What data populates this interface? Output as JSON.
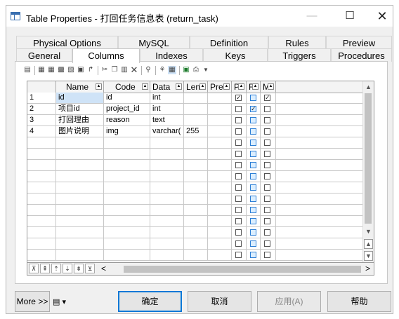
{
  "window": {
    "title": "Table Properties - 打回任务信息表 (return_task)",
    "minimize_label": "—",
    "maximize_label": "☐",
    "close_label": "✕"
  },
  "tabs": {
    "row1": [
      "Physical Options",
      "MySQL",
      "Definition",
      "Rules",
      "Preview"
    ],
    "row2": [
      "General",
      "Columns",
      "Indexes",
      "Keys",
      "Triggers",
      "Procedures"
    ],
    "active": "Columns"
  },
  "toolbar": {
    "icons": [
      "properties-icon",
      "insert-row-icon",
      "add-row-icon",
      "add-rows-icon",
      "delete-row-icon",
      "filter-icon",
      "cut-icon",
      "copy-icon",
      "paste-icon",
      "delete-icon",
      "find-icon",
      "customize-filter-icon",
      "customize-columns-icon",
      "excel-export-icon",
      "print-icon",
      "dropdown-icon"
    ]
  },
  "grid": {
    "columns": [
      "Name",
      "Code",
      "Data",
      "Len",
      "Pre",
      "P",
      "F",
      "M"
    ],
    "rows": [
      {
        "num": "1",
        "name": "id",
        "code": "id",
        "data": "int",
        "len": "",
        "pre": "",
        "p": true,
        "f": false,
        "m": true
      },
      {
        "num": "2",
        "name": "项目id",
        "code": "project_id",
        "data": "int",
        "len": "",
        "pre": "",
        "p": false,
        "f": true,
        "m": false
      },
      {
        "num": "3",
        "name": "打回理由",
        "code": "reason",
        "data": "text",
        "len": "",
        "pre": "",
        "p": false,
        "f": false,
        "m": false
      },
      {
        "num": "4",
        "name": "图片说明",
        "code": "img",
        "data": "varchar(",
        "len": "255",
        "pre": "",
        "p": false,
        "f": false,
        "m": false
      }
    ],
    "empty_rows": 11
  },
  "nav": {
    "buttons": [
      "⊼",
      "⇞",
      "⇡",
      "⇣",
      "⇟",
      "⊻"
    ],
    "scroll_left": "<",
    "scroll_right": ">"
  },
  "bottom": {
    "more_label": "More >>",
    "ok_label": "确定",
    "cancel_label": "取消",
    "apply_label": "应用(A)",
    "help_label": "帮助"
  }
}
